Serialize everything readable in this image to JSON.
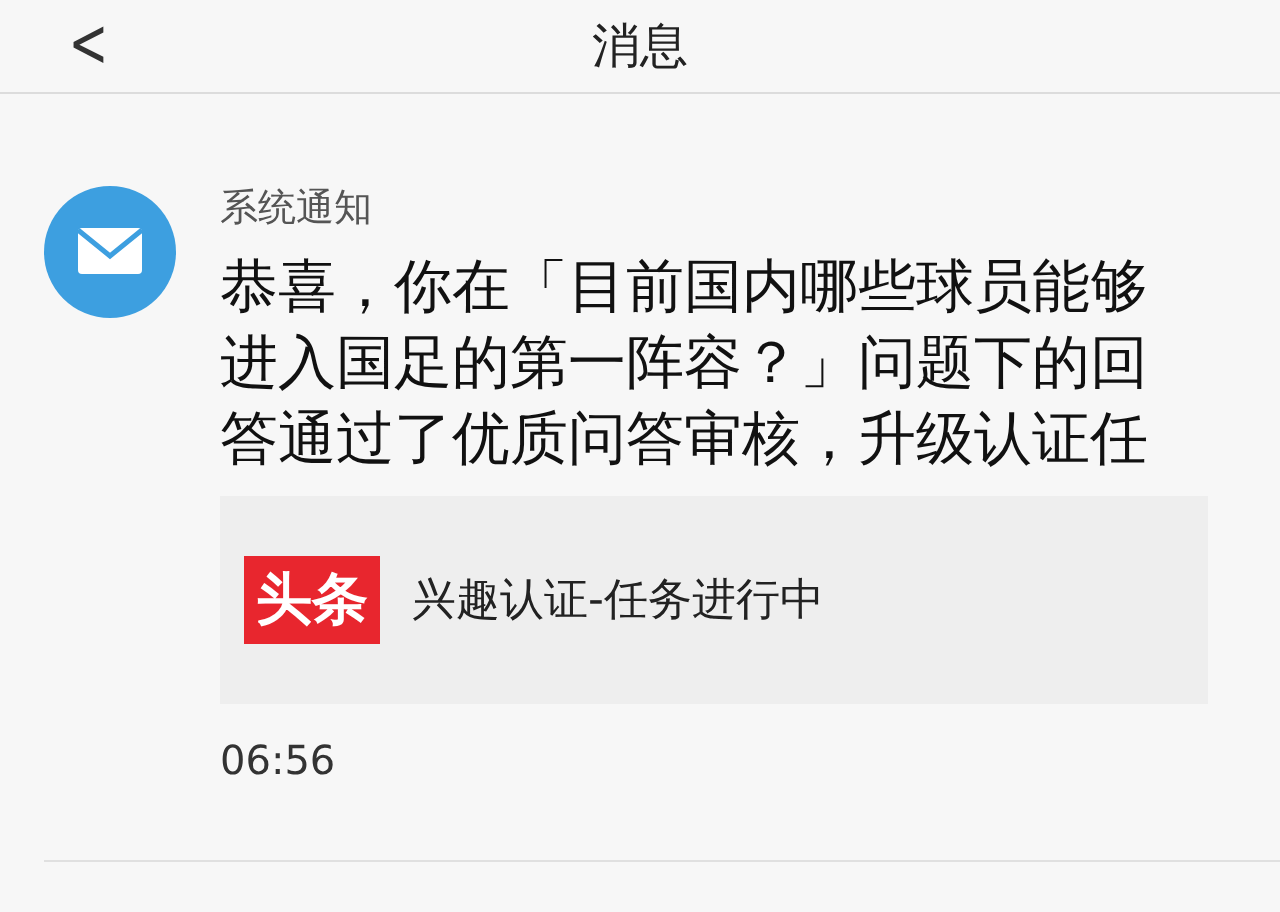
{
  "header": {
    "back": "<",
    "title": "消息"
  },
  "notice": {
    "sender": "系统通知",
    "message": "恭喜，你在「目前国内哪些球员能够进入国足的第一阵容？」问题下的回答通过了优质问答审核，升级认证任",
    "card": {
      "logo": "头条",
      "text": "兴趣认证-任务进行中"
    },
    "time": "06:56"
  }
}
